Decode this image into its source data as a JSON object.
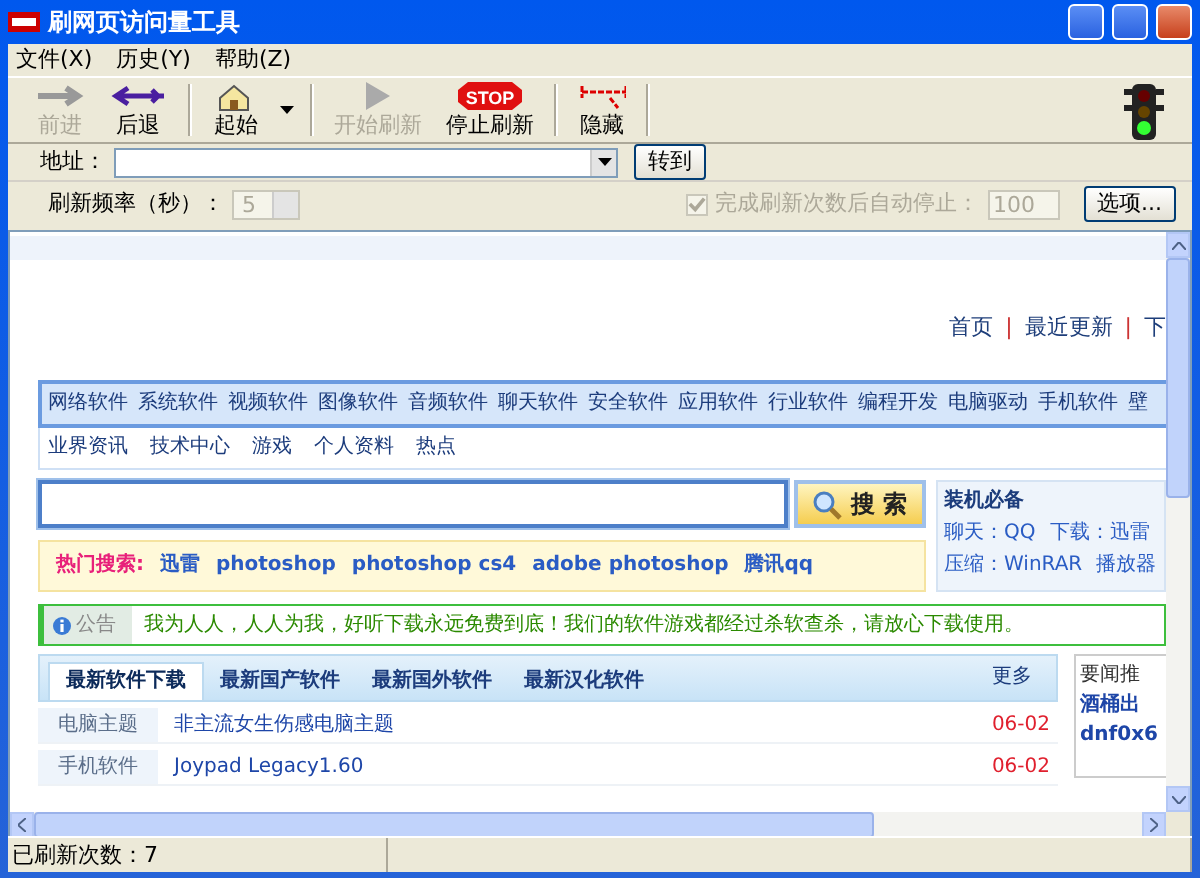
{
  "window": {
    "title": "刷网页访问量工具"
  },
  "menu": [
    {
      "label": "文件(X)"
    },
    {
      "label": "历史(Y)"
    },
    {
      "label": "帮助(Z)"
    }
  ],
  "toolbar_groups": [
    [
      {
        "label": "前进",
        "kind": "forward",
        "disabled": true
      },
      {
        "label": "后退",
        "kind": "back",
        "disabled": false
      }
    ],
    [
      {
        "label": "起始",
        "kind": "home",
        "disabled": false,
        "dropdown": true
      }
    ],
    [
      {
        "label": "开始刷新",
        "kind": "play",
        "disabled": true
      },
      {
        "label": "停止刷新",
        "kind": "stop",
        "sign_text": "STOP",
        "disabled": false
      }
    ],
    [
      {
        "label": "隐藏",
        "kind": "hide",
        "disabled": false
      }
    ]
  ],
  "address": {
    "label": "地址：",
    "go_button": "转到"
  },
  "refresh": {
    "label": "刷新频率（秒）：",
    "value": "5",
    "disabled": true,
    "auto_stop_label": "完成刷新次数后自动停止：",
    "auto_stop_checked": true,
    "auto_stop_disabled": true,
    "count": "100",
    "options_button": "选项..."
  },
  "page": {
    "top_links": [
      "首页",
      "最近更新",
      "下"
    ],
    "separators": [
      "|",
      "|"
    ],
    "nav": [
      "网络软件",
      "系统软件",
      "视频软件",
      "图像软件",
      "音频软件",
      "聊天软件",
      "安全软件",
      "应用软件",
      "行业软件",
      "编程开发",
      "电脑驱动",
      "手机软件",
      "壁"
    ],
    "subnav": [
      "业界资讯",
      "技术中心",
      "游戏",
      "个人资料",
      "热点"
    ],
    "search_button": "搜 索",
    "essentials": {
      "title": "装机必备",
      "lines": [
        [
          "聊天：QQ",
          "下载：迅雷"
        ],
        [
          "压缩：WinRAR",
          "播放器"
        ]
      ]
    },
    "hot": {
      "label": "热门搜索:",
      "terms": [
        "迅雷",
        "photoshop",
        "photoshop cs4",
        "adobe photoshop",
        "腾讯qq"
      ]
    },
    "notice": {
      "label": "公告",
      "text": "我为人人，人人为我，好听下载永远免费到底！我们的软件游戏都经过杀软查杀，请放心下载使用。"
    },
    "tabs": [
      {
        "label": "最新软件下载",
        "selected": true
      },
      {
        "label": "最新国产软件",
        "selected": false
      },
      {
        "label": "最新国外软件",
        "selected": false
      },
      {
        "label": "最新汉化软件",
        "selected": false
      }
    ],
    "more": "更多",
    "rows": [
      {
        "category": "电脑主题",
        "title": "非主流女生伤感电脑主题",
        "date": "06-02"
      },
      {
        "category": "手机软件",
        "title": "Joypad Legacy1.60",
        "date": "06-02"
      }
    ],
    "side": {
      "title": "要闻推",
      "items": [
        "酒桶出",
        "dnf0x6"
      ]
    }
  },
  "status_bar": {
    "text": "已刷新次数：7"
  }
}
